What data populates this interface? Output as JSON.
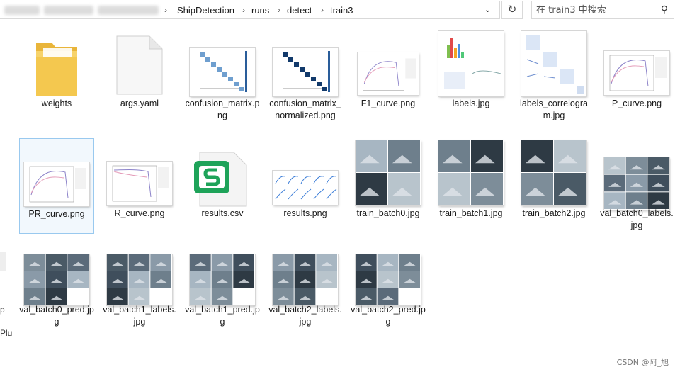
{
  "address_bar": {
    "breadcrumb": [
      "ShipDetection",
      "runs",
      "detect",
      "train3"
    ],
    "separator": "›",
    "dropdown_icon": "chevron-down-icon",
    "refresh_icon": "refresh-icon",
    "refresh_glyph": "↻",
    "dropdown_glyph": "⌄"
  },
  "search": {
    "placeholder": "在 train3 中搜索",
    "icon": "search-icon",
    "glyph": "⚲"
  },
  "left_pane_fragments": [
    "p",
    "Plu"
  ],
  "files": [
    {
      "name": "weights",
      "type": "folder"
    },
    {
      "name": "args.yaml",
      "type": "blank-file"
    },
    {
      "name": "confusion_matrix.png",
      "type": "image"
    },
    {
      "name": "confusion_matrix_normalized.png",
      "type": "image"
    },
    {
      "name": "F1_curve.png",
      "type": "image"
    },
    {
      "name": "labels.jpg",
      "type": "image"
    },
    {
      "name": "labels_correlogram.jpg",
      "type": "image"
    },
    {
      "name": "P_curve.png",
      "type": "image"
    },
    {
      "name": "PR_curve.png",
      "type": "image",
      "selected": true
    },
    {
      "name": "R_curve.png",
      "type": "image"
    },
    {
      "name": "results.csv",
      "type": "spreadsheet"
    },
    {
      "name": "results.png",
      "type": "image"
    },
    {
      "name": "train_batch0.jpg",
      "type": "image"
    },
    {
      "name": "train_batch1.jpg",
      "type": "image"
    },
    {
      "name": "train_batch2.jpg",
      "type": "image"
    },
    {
      "name": "val_batch0_labels.jpg",
      "type": "image"
    },
    {
      "name": "val_batch0_pred.jpg",
      "type": "image"
    },
    {
      "name": "val_batch1_labels.jpg",
      "type": "image"
    },
    {
      "name": "val_batch1_pred.jpg",
      "type": "image"
    },
    {
      "name": "val_batch2_labels.jpg",
      "type": "image"
    },
    {
      "name": "val_batch2_pred.jpg",
      "type": "image"
    }
  ],
  "watermark": "CSDN @阿_旭",
  "colors": {
    "selection_border": "#99c9ef",
    "folder": "#f4c84f",
    "spreadsheet_green": "#1ea359"
  }
}
